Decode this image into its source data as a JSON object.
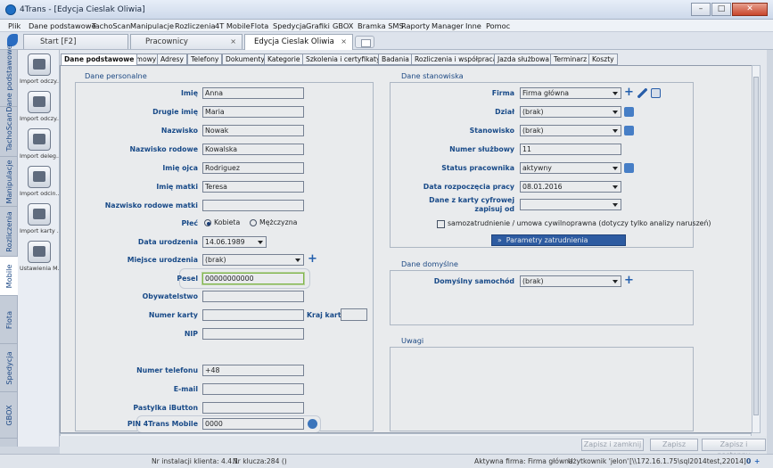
{
  "window": {
    "title": "4Trans - [Edycja Cieslak Oliwia]"
  },
  "menu": [
    "Plik",
    "Dane podstawowe",
    "TachoScan",
    "Manipulacje",
    "Rozliczenia",
    "4T Mobile",
    "Flota",
    "Spedycja",
    "Grafiki",
    "GBOX",
    "Bramka SMS",
    "Raporty",
    "Manager",
    "Inne",
    "Pomoc"
  ],
  "doc_tabs": [
    "Start [F2]",
    "Pracownicy",
    "Edycja Cieslak Oliwia"
  ],
  "vertical_tabs": [
    "Dane podstawowe",
    "TachoScan",
    "Manipulacje",
    "Rozliczenia",
    "Mobile",
    "Flota",
    "Spedycja",
    "GBOX"
  ],
  "launcher": [
    "Import odczy...",
    "Import odczy...",
    "Import deleg...",
    "Import odcin...",
    "Import karty ...",
    "Ustawienia M..."
  ],
  "page_tabs": [
    "Dane podstawowe",
    "Umowy",
    "Adresy",
    "Telefony",
    "Dokumenty",
    "Kategorie",
    "Szkolenia i certyfikaty",
    "Badania",
    "Rozliczenia i współpraca",
    "Jazda służbowa",
    "Terminarz",
    "Koszty"
  ],
  "personal": {
    "title": "Dane personalne",
    "imie": {
      "label": "Imię",
      "value": "Anna"
    },
    "drugie_imie": {
      "label": "Drugie imię",
      "value": "Maria"
    },
    "nazwisko": {
      "label": "Nazwisko",
      "value": "Nowak"
    },
    "nazwisko_rodowe": {
      "label": "Nazwisko rodowe",
      "value": "Kowalska"
    },
    "imie_ojca": {
      "label": "Imię ojca",
      "value": "Rodriguez"
    },
    "imie_matki": {
      "label": "Imię matki",
      "value": "Teresa"
    },
    "nazwisko_rodowe_matki": {
      "label": "Nazwisko rodowe matki",
      "value": ""
    },
    "plec": {
      "label": "Płeć",
      "options": [
        "Kobieta",
        "Mężczyzna"
      ],
      "selected": "Kobieta"
    },
    "data_urodzenia": {
      "label": "Data urodzenia",
      "value": "14.06.1989"
    },
    "miejsce_urodzenia": {
      "label": "Miejsce urodzenia",
      "value": "(brak)"
    },
    "pesel": {
      "label": "Pesel",
      "value": "00000000000"
    },
    "obywatelstwo": {
      "label": "Obywatelstwo",
      "value": ""
    },
    "numer_karty": {
      "label": "Numer karty",
      "value": ""
    },
    "kraj_karty": {
      "label": "Kraj karty",
      "value": ""
    },
    "nip": {
      "label": "NIP",
      "value": ""
    },
    "numer_telefonu": {
      "label": "Numer telefonu",
      "value": "+48"
    },
    "email": {
      "label": "E-mail",
      "value": ""
    },
    "pastylka": {
      "label": "Pastylka iButton",
      "value": ""
    },
    "pin": {
      "label": "PIN 4Trans Mobile",
      "value": "0000"
    }
  },
  "position": {
    "title": "Dane stanowiska",
    "firma": {
      "label": "Firma",
      "value": "Firma główna"
    },
    "dzial": {
      "label": "Dział",
      "value": "(brak)"
    },
    "stanowisko": {
      "label": "Stanowisko",
      "value": "(brak)"
    },
    "numer_sluzbowy": {
      "label": "Numer służbowy",
      "value": "11"
    },
    "status": {
      "label": "Status pracownika",
      "value": "aktywny"
    },
    "data_rozpoczecia": {
      "label": "Data rozpoczęcia pracy",
      "value": "08.01.2016"
    },
    "dane_z_karty_1": "Dane z karty cyfrowej",
    "dane_z_karty_2": "zapisuj od",
    "dane_z_karty_value": "",
    "samozatrudnienie": {
      "label": "samozatrudnienie / umowa cywilnoprawna (dotyczy tylko analizy naruszeń)",
      "checked": false
    },
    "parametry_button": "Parametry zatrudnienia"
  },
  "defaults": {
    "title": "Dane domyślne",
    "samochod": {
      "label": "Domyślny samochód",
      "value": "(brak)"
    }
  },
  "notes": {
    "title": "Uwagi"
  },
  "actions": {
    "save_close": "Zapisz i zamknij",
    "save": "Zapisz",
    "save_next": "Zapisz i następny"
  },
  "status": {
    "install": "Nr instalacji klienta: 4.4.1",
    "key": "Nr klucza:284 ()",
    "firm": "Aktywna firma: Firma główna",
    "user": "Użytkownik 'jelon'",
    "server": "[\\\\172.16.1.75\\sql2014test,22014]",
    "count": "0"
  },
  "colors": {
    "label_blue": "#174c8f",
    "accent": "#2e5fab"
  }
}
